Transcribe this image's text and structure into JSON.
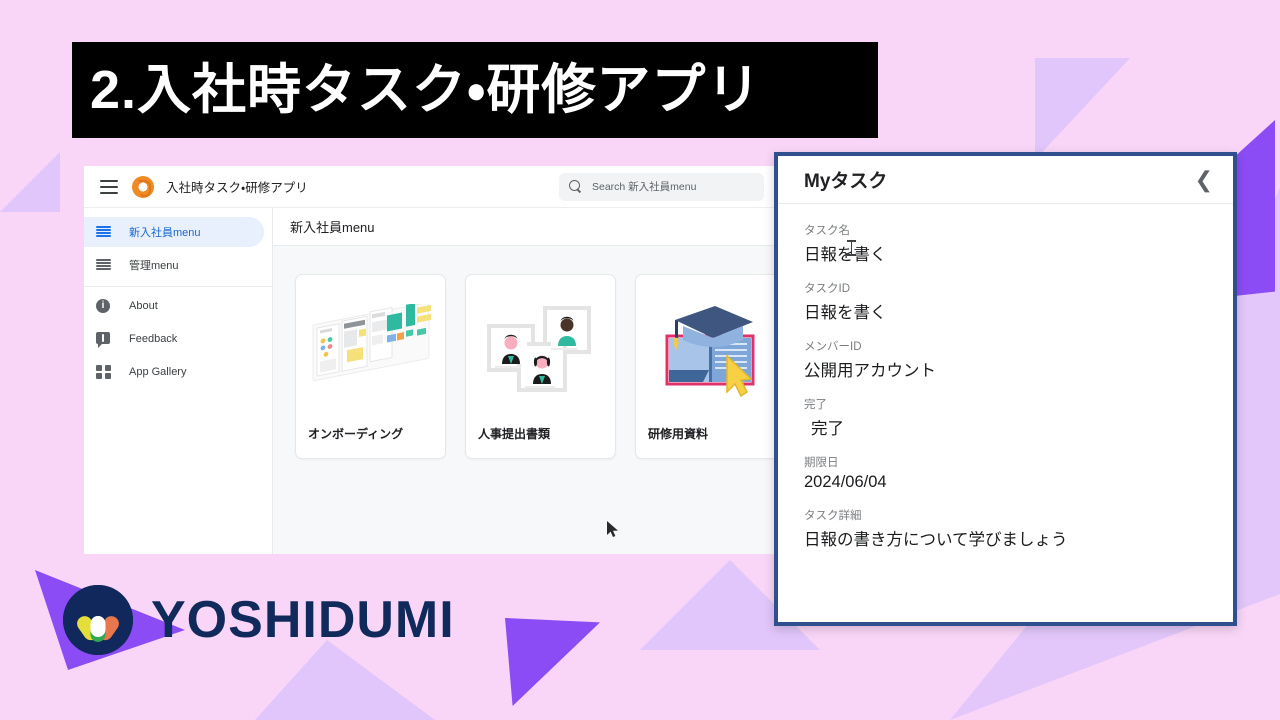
{
  "slide": {
    "title": "2.入社時タスク・研修アプリ",
    "background_color": "#f9d6f7",
    "accent_purple": "#8c4cf5",
    "accent_lavender": "#e0c6fa"
  },
  "app": {
    "header": {
      "menu_icon": "hamburger-icon",
      "logo_icon": "app-logo-icon",
      "title": "入社時タスク・研修アプリ",
      "search": {
        "icon": "search-icon",
        "placeholder": "Search 新入社員menu",
        "value": ""
      }
    },
    "sidebar": {
      "items": [
        {
          "label": "新入社員menu",
          "icon": "list-lines-icon",
          "selected": true
        },
        {
          "label": "管理menu",
          "icon": "list-lines-icon",
          "selected": false
        },
        {
          "label": "About",
          "icon": "info-icon",
          "selected": false
        },
        {
          "label": "Feedback",
          "icon": "feedback-icon",
          "selected": false
        },
        {
          "label": "App Gallery",
          "icon": "grid-icon",
          "selected": false
        }
      ]
    },
    "main": {
      "page_title": "新入社員menu",
      "cards": [
        {
          "label": "オンボーディング",
          "icon": "kanban-board-illustration"
        },
        {
          "label": "人事提出書類",
          "icon": "id-photos-illustration"
        },
        {
          "label": "研修用資料",
          "icon": "graduation-book-illustration"
        }
      ]
    },
    "cursor": {
      "icon": "mouse-pointer-icon"
    }
  },
  "task_panel": {
    "title": "Myタスク",
    "collapse_icon": "chevron-left-icon",
    "border_color": "#2f4f8f",
    "fields": [
      {
        "label": "タスク名",
        "value": "日報を書く"
      },
      {
        "label": "タスクID",
        "value": "日報を書く"
      },
      {
        "label": "メンバーID",
        "value": "公開用アカウント"
      },
      {
        "label": "完了",
        "value": "完了"
      },
      {
        "label": "期限日",
        "value": "2024/06/04"
      },
      {
        "label": "タスク詳細",
        "value": "日報の書き方について学びましょう"
      }
    ],
    "text_caret_icon": "text-caret-icon"
  },
  "brand": {
    "name": "YOSHIDUMI",
    "mark_icon": "yoshidumi-logo-mark",
    "color": "#102a5c"
  }
}
